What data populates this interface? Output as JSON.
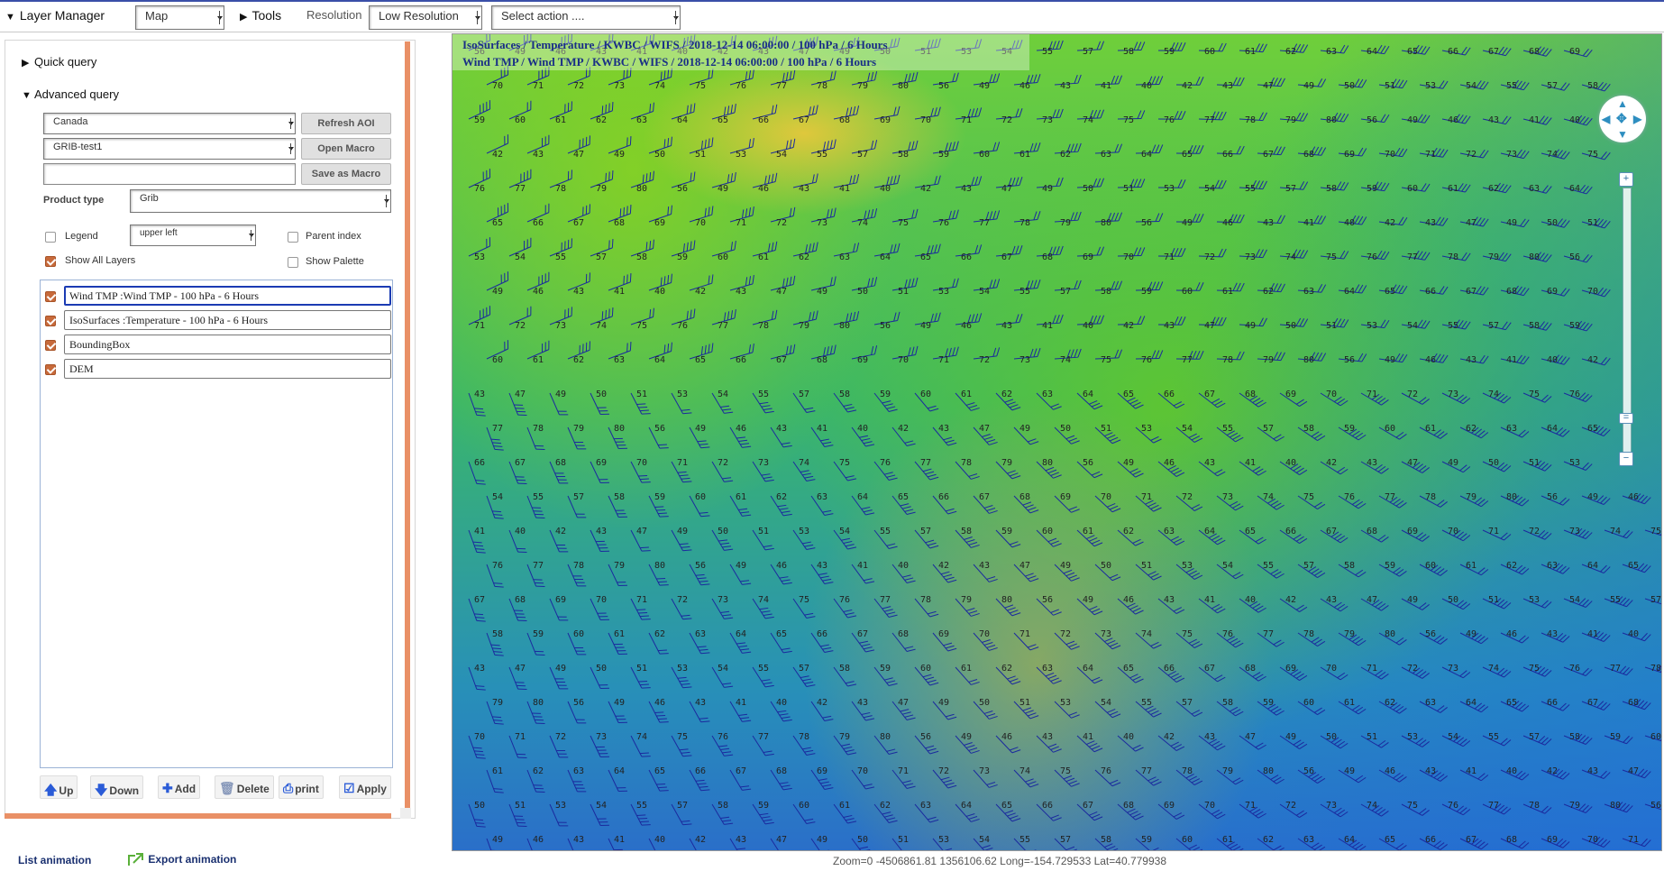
{
  "topbar": {
    "layer_manager": "Layer Manager",
    "map_select": "Map",
    "tools": "Tools",
    "resolution_label": "Resolution",
    "resolution_select": "Low Resolution",
    "action_select": "Select action ...."
  },
  "panel": {
    "quick_query": "Quick query",
    "advanced_query": "Advanced query",
    "region_select": "Canada",
    "macro_select": "GRIB-test1",
    "macro_name_value": "",
    "refresh_aoi": "Refresh AOI",
    "open_macro": "Open Macro",
    "save_as_macro": "Save as Macro",
    "product_type_label": "Product type",
    "product_type_select": "Grib",
    "legend_label": "Legend",
    "legend_checked": false,
    "legend_position_select": "upper left",
    "parent_index_label": "Parent index",
    "parent_index_checked": false,
    "show_all_layers_label": "Show All Layers",
    "show_all_layers_checked": true,
    "show_palette_label": "Show Palette",
    "show_palette_checked": false,
    "layers": [
      {
        "label": "Wind TMP :Wind TMP - 100 hPa - 6 Hours",
        "checked": true,
        "selected": true
      },
      {
        "label": "IsoSurfaces :Temperature - 100 hPa - 6 Hours",
        "checked": true,
        "selected": false
      },
      {
        "label": "BoundingBox",
        "checked": true,
        "selected": false
      },
      {
        "label": "DEM",
        "checked": true,
        "selected": false
      }
    ],
    "buttons": {
      "up": "Up",
      "down": "Down",
      "add": "Add",
      "delete": "Delete",
      "print": "print",
      "apply": "Apply"
    }
  },
  "map": {
    "title_line1": "IsoSurfaces / Temperature / KWBC / WIFS / 2018-12-14 06:00:00 / 100 hPa / 6 Hours",
    "title_line2": "Wind TMP / Wind TMP / KWBC / WIFS / 2018-12-14 06:00:00 / 100 hPa / 6 Hours",
    "wind_labels": [
      "56",
      "49",
      "46",
      "43",
      "41",
      "40",
      "42",
      "43",
      "47",
      "49",
      "50",
      "51",
      "53",
      "54",
      "55",
      "57",
      "58",
      "59",
      "60",
      "61",
      "62",
      "63",
      "64",
      "65",
      "66",
      "67",
      "68",
      "69",
      "70",
      "71",
      "72",
      "73",
      "74",
      "75",
      "76",
      "77",
      "78",
      "79",
      "80"
    ]
  },
  "footer": {
    "list_animation": "List animation",
    "export_animation": "Export animation",
    "status": "Zoom=0 -4506861.81 1356106.62 Long=-154.729533 Lat=40.779938"
  },
  "colors": {
    "accent": "#1b3bb3",
    "scroll": "#e99066",
    "checkbox": "#c76a3b",
    "wind_barb": "#1b2a9e"
  },
  "icons": [
    "triangle-down-icon",
    "triangle-right-icon",
    "arrow-up-icon",
    "arrow-down-icon",
    "plus-icon",
    "trash-icon",
    "printer-icon",
    "check-icon",
    "export-icon",
    "pan-icon",
    "zoom-in-icon",
    "zoom-out-icon"
  ]
}
